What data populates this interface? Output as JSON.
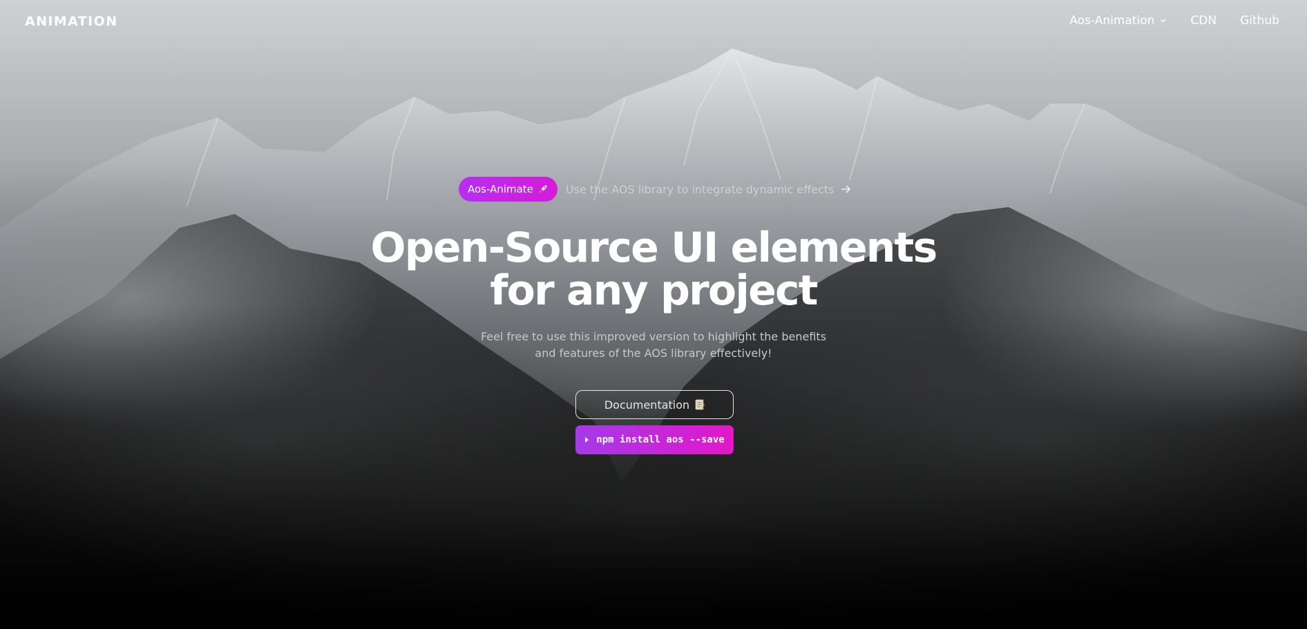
{
  "nav": {
    "logo": "ANIMATION",
    "links": [
      {
        "label": "Aos-Animation",
        "icon": "chevron-down-icon"
      },
      {
        "label": "CDN"
      },
      {
        "label": "Github"
      }
    ]
  },
  "announcement": {
    "badge_label": "Aos-Animate",
    "badge_icon": "rocket-icon",
    "text": "Use the AOS library to integrate dynamic effects",
    "arrow_icon": "arrow-right-icon"
  },
  "hero": {
    "title_line1": "Open-Source UI elements",
    "title_line2": "for any project",
    "subtitle_line1": "Feel free to use this improved version to highlight the benefits",
    "subtitle_line2": "and features of the AOS library effectively!"
  },
  "buttons": {
    "docs_label": "Documentation",
    "docs_icon": "memo-icon",
    "npm_command": "npm install aos --save",
    "npm_icon": "play-triangle-icon"
  },
  "colors": {
    "accent_start": "#a43ae8",
    "accent_end": "#e317c9",
    "background": "#0b0b0b"
  }
}
